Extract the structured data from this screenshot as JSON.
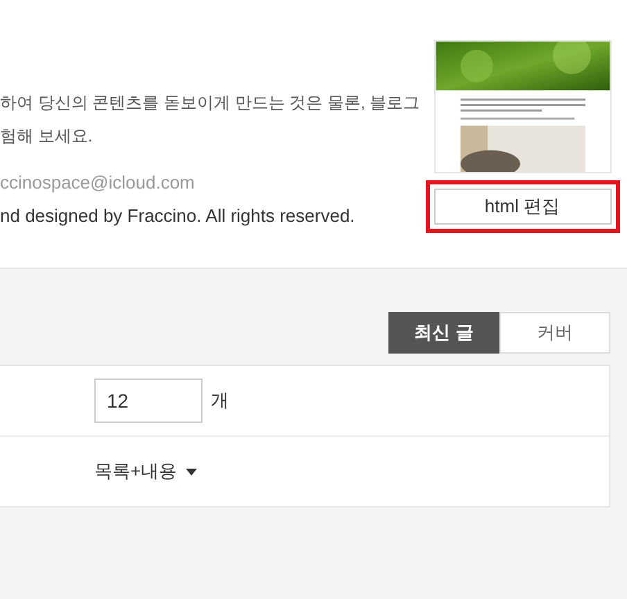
{
  "description": {
    "lines": [
      "하여 당신의 콘텐츠를 돋보이게 만드는 것은 물론, 블로그",
      "험해 보세요."
    ],
    "email": "ccinospace@icloud.com",
    "copyright": "nd designed by Fraccino. All rights reserved."
  },
  "theme": {
    "edit_button": "html 편집",
    "highlighted": true
  },
  "tabs": [
    {
      "label": "최신 글",
      "selected": true
    },
    {
      "label": "커버",
      "selected": false
    }
  ],
  "settings": {
    "count": {
      "value": "12",
      "unit": "개"
    },
    "display": {
      "value": "목록+내용"
    }
  }
}
